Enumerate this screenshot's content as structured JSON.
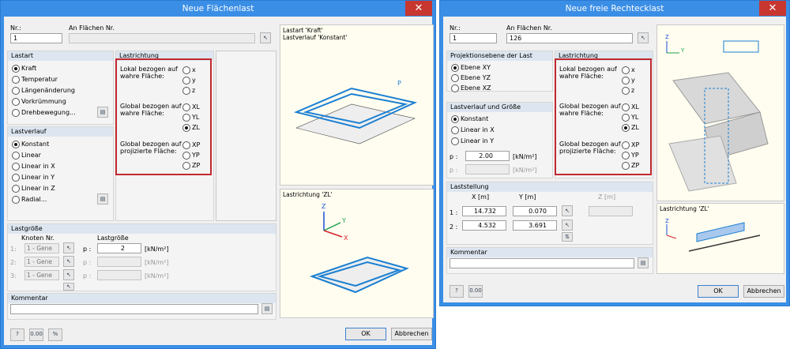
{
  "left": {
    "title": "Neue Flächenlast",
    "close": "✕",
    "nr_label": "Nr.:",
    "nr_value": "1",
    "flaechen_label": "An Flächen Nr.",
    "flaechen_value": "",
    "lastart": {
      "header": "Lastart",
      "items": [
        "Kraft",
        "Temperatur",
        "Längenänderung",
        "Vorkrümmung",
        "Drehbewegung..."
      ]
    },
    "lastrichtung": {
      "header": "Lastrichtung",
      "g1": "Lokal bezogen auf wahre Fläche:",
      "g2": "Global bezogen auf wahre Fläche:",
      "g3": "Global bezogen auf projizierte Fläche:",
      "opts1": [
        "x",
        "y",
        "z"
      ],
      "opts2": [
        "XL",
        "YL",
        "ZL"
      ],
      "opts3": [
        "XP",
        "YP",
        "ZP"
      ]
    },
    "lastverlauf": {
      "header": "Lastverlauf",
      "items": [
        "Konstant",
        "Linear",
        "Linear in X",
        "Linear in Y",
        "Linear in Z",
        "Radial..."
      ]
    },
    "lastgroesse": {
      "header": "Lastgröße",
      "knoten": "Knoten Nr.",
      "lastgr": "Lastgröße",
      "rows": [
        "1:",
        "2:",
        "3:"
      ],
      "gen": "1 - Gene",
      "p": "p :",
      "p_value": "2",
      "unit": "[kN/m²]"
    },
    "kommentar": "Kommentar",
    "preview_top": "Lastart 'Kraft'\nLastverlauf 'Konstant'",
    "preview_bottom": "Lastrichtung 'ZL'",
    "ok": "OK",
    "cancel": "Abbrechen"
  },
  "right": {
    "title": "Neue freie Rechtecklast",
    "close": "✕",
    "nr_label": "Nr.:",
    "nr_value": "1",
    "flaechen_label": "An Flächen Nr.",
    "flaechen_value": "126",
    "projektion": {
      "header": "Projektionsebene der Last",
      "items": [
        "Ebene XY",
        "Ebene YZ",
        "Ebene XZ"
      ]
    },
    "lastrichtung": {
      "header": "Lastrichtung",
      "g1": "Lokal bezogen auf wahre Fläche:",
      "g2": "Global bezogen auf wahre Fläche:",
      "g3": "Global bezogen auf projizierte Fläche:",
      "opts1": [
        "x",
        "y",
        "z"
      ],
      "opts2": [
        "XL",
        "YL",
        "ZL"
      ],
      "opts3": [
        "XP",
        "YP",
        "ZP"
      ]
    },
    "verlauf": {
      "header": "Lastverlauf und Größe",
      "items": [
        "Konstant",
        "Linear in X",
        "Linear in Y"
      ],
      "p": "p :",
      "p_value": "2.00",
      "unit": "[kN/m²]"
    },
    "laststellung": {
      "header": "Laststellung",
      "x": "X [m]",
      "y": "Y [m]",
      "z": "Z [m]",
      "r1": "1 :",
      "r2": "2 :",
      "x1": "14.732",
      "y1": "0.070",
      "x2": "4.532",
      "y2": "3.691"
    },
    "kommentar": "Kommentar",
    "preview_bottom": "Lastrichtung 'ZL'",
    "ok": "OK",
    "cancel": "Abbrechen"
  }
}
